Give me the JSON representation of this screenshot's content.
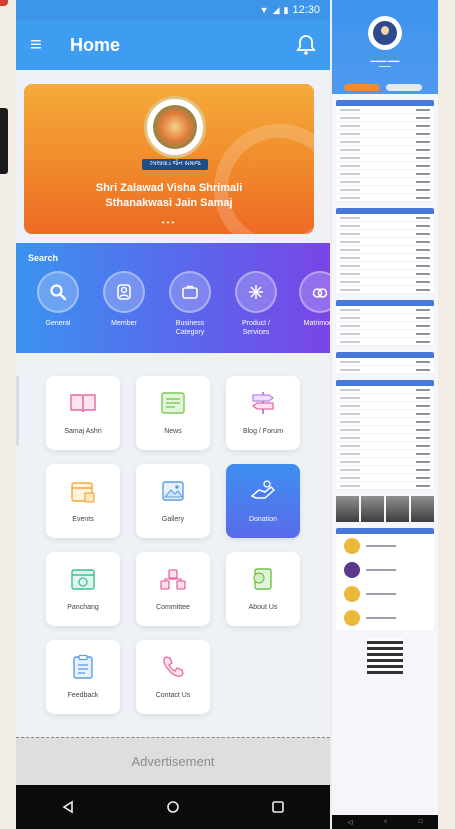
{
  "status_bar": {
    "time": "12:30"
  },
  "app_bar": {
    "title": "Home",
    "menu_icon": "hamburger-menu-icon",
    "bell_icon": "notification-bell-icon"
  },
  "banner": {
    "line1": "Shri Zalawad Visha Shrimali",
    "line2": "Sthanakwasi Jain Samaj",
    "emblem_caption": "ઝાલાવાડ જૈન સમાજ",
    "dots": "•••"
  },
  "search": {
    "label": "Search",
    "items": [
      {
        "label": "General",
        "icon": "search-icon"
      },
      {
        "label": "Member",
        "icon": "user-icon"
      },
      {
        "label": "Business Category",
        "icon": "briefcase-icon"
      },
      {
        "label": "Product / Services",
        "icon": "sparkle-icon"
      },
      {
        "label": "Matrimony",
        "icon": "rings-icon"
      }
    ]
  },
  "grid": {
    "tiles": [
      {
        "label": "Samaj Ashri",
        "icon": "book-icon"
      },
      {
        "label": "News",
        "icon": "news-icon"
      },
      {
        "label": "Blog / Forum",
        "icon": "signpost-icon"
      },
      {
        "label": "Events",
        "icon": "calendar-icon"
      },
      {
        "label": "Gallery",
        "icon": "gallery-icon"
      },
      {
        "label": "Donation",
        "icon": "donation-hand-icon",
        "active": true
      },
      {
        "label": "Panchang",
        "icon": "panchang-calendar-icon"
      },
      {
        "label": "Committee",
        "icon": "committee-icon"
      },
      {
        "label": "About Us",
        "icon": "about-us-icon"
      },
      {
        "label": "Feedback",
        "icon": "feedback-clipboard-icon"
      },
      {
        "label": "Contact Us",
        "icon": "contact-phone-icon"
      }
    ]
  },
  "advertisement": {
    "label": "Advertisement"
  },
  "colors": {
    "app_blue": "#3f9df1",
    "banner_orange": "#f08a2b",
    "search_gradient_end": "#7a45e6",
    "active_tile": "#4a7ded"
  }
}
